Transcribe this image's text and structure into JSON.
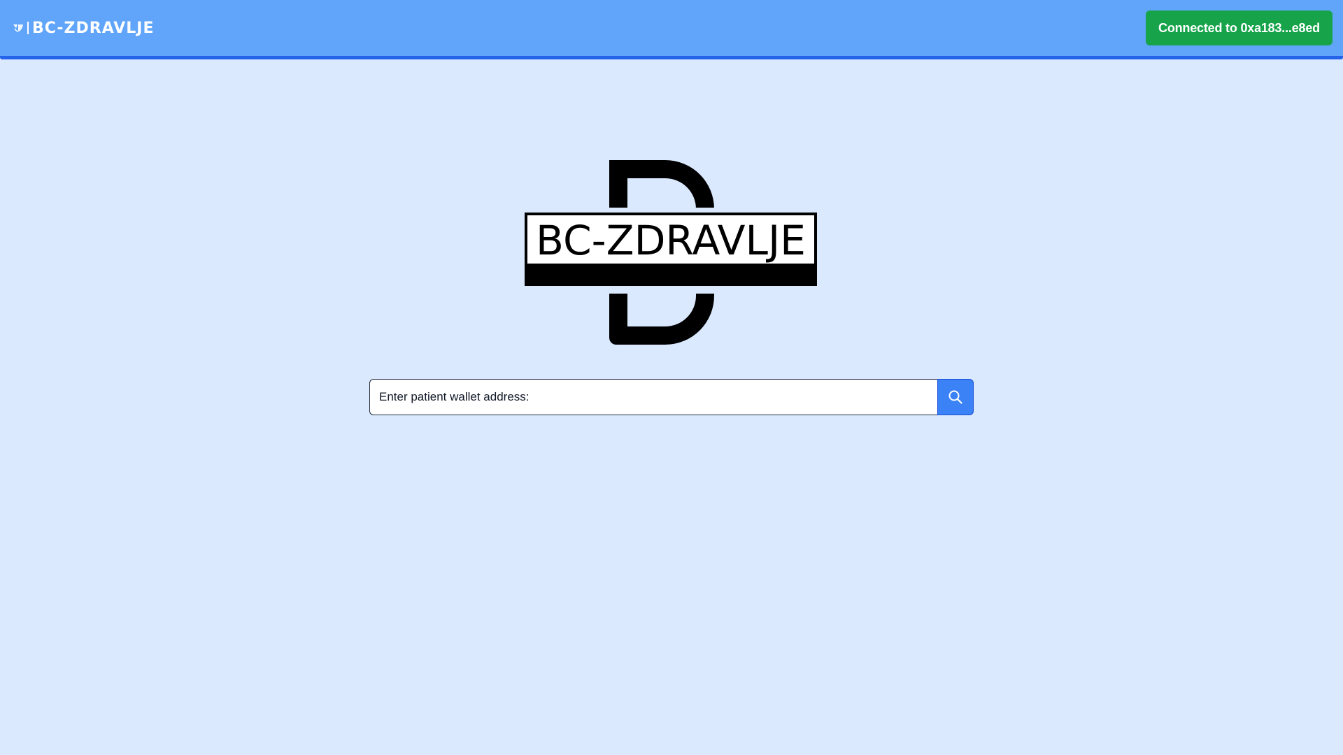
{
  "header": {
    "brand_text": "BC-ZDRAVLJE",
    "connect_button_label": "Connected to 0xa183...e8ed"
  },
  "logo": {
    "text": "BC-ZDRAVLJE"
  },
  "search": {
    "placeholder": "Enter patient wallet address:",
    "value": ""
  },
  "icons": {
    "brand_mark": "brand-logo-icon",
    "search_button": "search-icon"
  },
  "colors": {
    "navbar": "#60a5fa",
    "navbar_border": "#2563eb",
    "page_background": "#dbe9fe",
    "connect_button": "#16a34a",
    "search_button": "#3b82f6"
  }
}
